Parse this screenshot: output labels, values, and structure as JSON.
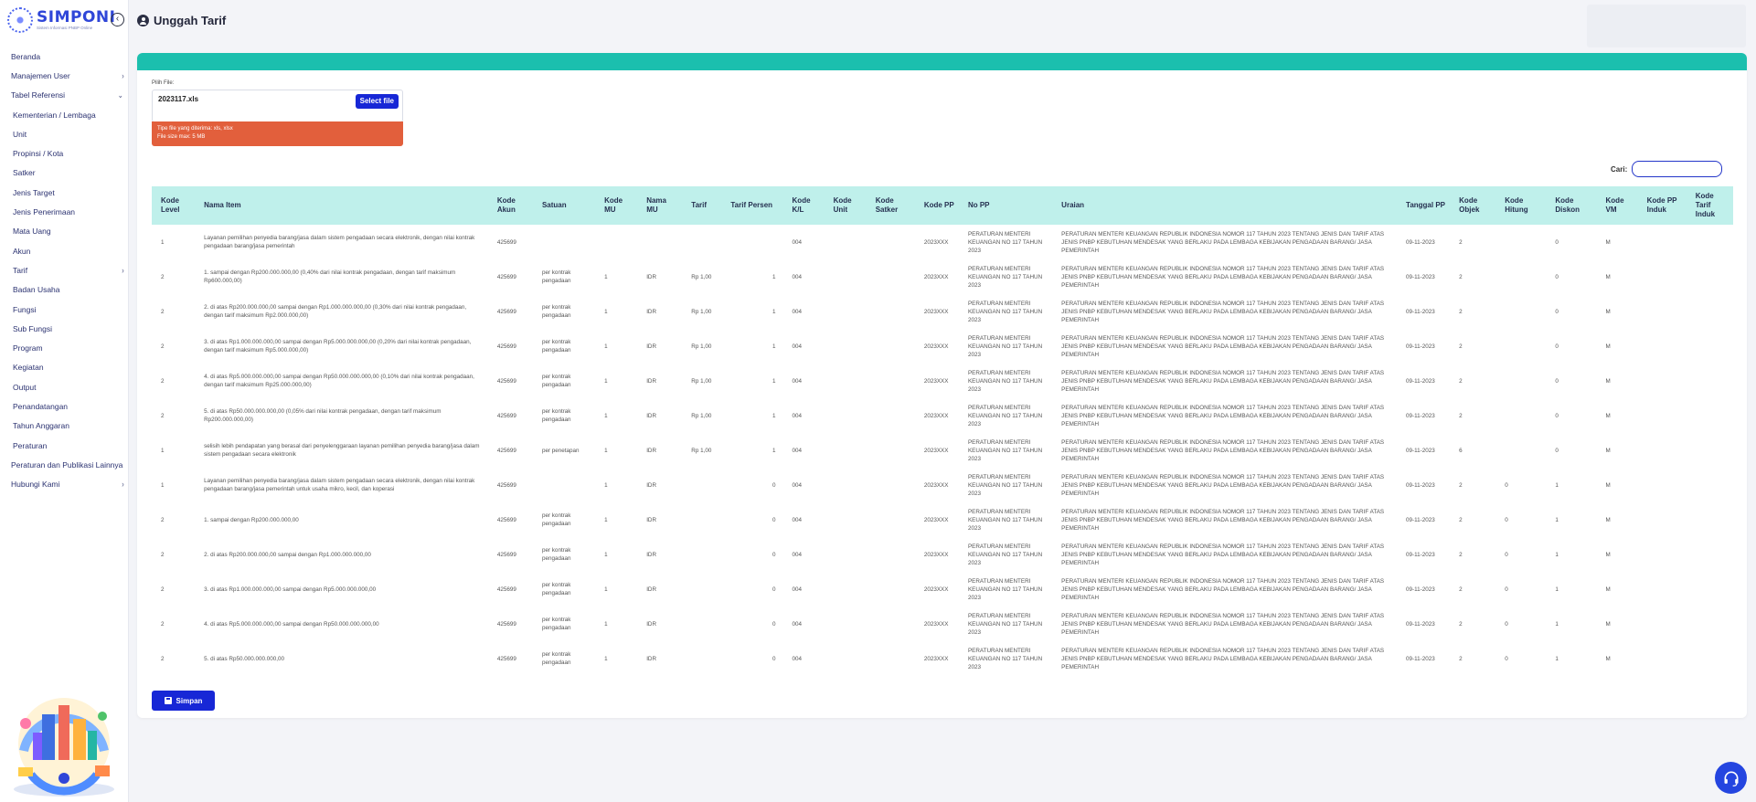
{
  "brand": {
    "name": "SIMPONI",
    "tagline": "Sistem Informasi PNBP Online"
  },
  "page": {
    "title": "Unggah Tarif"
  },
  "sidebar": {
    "items": [
      {
        "label": "Beranda",
        "sub": false,
        "chevron": ""
      },
      {
        "label": "Manajemen User",
        "sub": false,
        "chevron": "›"
      },
      {
        "label": "Tabel Referensi",
        "sub": false,
        "chevron": "⌄"
      },
      {
        "label": "Kementerian / Lembaga",
        "sub": true,
        "chevron": ""
      },
      {
        "label": "Unit",
        "sub": true,
        "chevron": ""
      },
      {
        "label": "Propinsi / Kota",
        "sub": true,
        "chevron": ""
      },
      {
        "label": "Satker",
        "sub": true,
        "chevron": ""
      },
      {
        "label": "Jenis Target",
        "sub": true,
        "chevron": ""
      },
      {
        "label": "Jenis Penerimaan",
        "sub": true,
        "chevron": ""
      },
      {
        "label": "Mata Uang",
        "sub": true,
        "chevron": ""
      },
      {
        "label": "Akun",
        "sub": true,
        "chevron": ""
      },
      {
        "label": "Tarif",
        "sub": true,
        "chevron": "›"
      },
      {
        "label": "Badan Usaha",
        "sub": true,
        "chevron": ""
      },
      {
        "label": "Fungsi",
        "sub": true,
        "chevron": ""
      },
      {
        "label": "Sub Fungsi",
        "sub": true,
        "chevron": ""
      },
      {
        "label": "Program",
        "sub": true,
        "chevron": ""
      },
      {
        "label": "Kegiatan",
        "sub": true,
        "chevron": ""
      },
      {
        "label": "Output",
        "sub": true,
        "chevron": ""
      },
      {
        "label": "Penandatangan",
        "sub": true,
        "chevron": ""
      },
      {
        "label": "Tahun Anggaran",
        "sub": true,
        "chevron": ""
      },
      {
        "label": "Peraturan",
        "sub": true,
        "chevron": ""
      },
      {
        "label": "Peraturan dan Publikasi Lainnya",
        "sub": false,
        "chevron": ""
      },
      {
        "label": "Hubungi Kami",
        "sub": false,
        "chevron": "›"
      }
    ]
  },
  "upload": {
    "label": "Pilih File:",
    "file_name": "2023117.xls",
    "select_label": "Select file",
    "note_types": "Tipe file yang diterima: xls, xlsx",
    "note_size": "File size max: 5 MB"
  },
  "search": {
    "label": "Cari:",
    "value": ""
  },
  "table": {
    "columns": [
      "Kode Level",
      "Nama Item",
      "Kode Akun",
      "Satuan",
      "Kode MU",
      "Nama MU",
      "Tarif",
      "Tarif Persen",
      "Kode K/L",
      "Kode Unit",
      "Kode Satker",
      "Kode PP",
      "No PP",
      "Uraian",
      "Tanggal PP",
      "Kode Objek",
      "Kode Hitung",
      "Kode Diskon",
      "Kode VM",
      "Kode PP Induk",
      "Kode Tarif Induk"
    ],
    "rows": [
      [
        "1",
        "Layanan pemilihan penyedia barang/jasa dalam sistem pengadaan secara elektronik, dengan nilai kontrak pengadaan barang/jasa pemerintah",
        "425699",
        "",
        "",
        "",
        "",
        "",
        "004",
        "",
        "",
        "2023XXX",
        "PERATURAN MENTERI KEUANGAN NO 117 TAHUN 2023",
        "PERATURAN MENTERI KEUANGAN REPUBLIK INDONESIA NOMOR 117 TAHUN 2023 TENTANG JENIS DAN TARIF ATAS JENIS PNBP KEBUTUHAN MENDESAK YANG BERLAKU PADA LEMBAGA KEBIJAKAN PENGADAAN BARANG/ JASA PEMERINTAH",
        "09-11-2023",
        "2",
        "",
        "0",
        "M",
        "",
        ""
      ],
      [
        "2",
        "1.     sampai dengan Rp200.000.000,00 (0,40% dari nilai kontrak pengadaan, dengan tarif maksimum Rp600.000,00)",
        "425699",
        "per kontrak pengadaan",
        "1",
        "IDR",
        "Rp 1,00",
        "1",
        "004",
        "",
        "",
        "2023XXX",
        "PERATURAN MENTERI KEUANGAN NO 117 TAHUN 2023",
        "PERATURAN MENTERI KEUANGAN REPUBLIK INDONESIA NOMOR 117 TAHUN 2023 TENTANG JENIS DAN TARIF ATAS JENIS PNBP KEBUTUHAN MENDESAK YANG BERLAKU PADA LEMBAGA KEBIJAKAN PENGADAAN BARANG/ JASA PEMERINTAH",
        "09-11-2023",
        "2",
        "",
        "0",
        "M",
        "",
        ""
      ],
      [
        "2",
        "2.     di atas Rp200.000.000,00 sampai dengan Rp1.000.000.000,00 (0,30% dari nilai kontrak pengadaan, dengan tarif maksimum Rp2.000.000,00)",
        "425699",
        "per kontrak pengadaan",
        "1",
        "IDR",
        "Rp 1,00",
        "1",
        "004",
        "",
        "",
        "2023XXX",
        "PERATURAN MENTERI KEUANGAN NO 117 TAHUN 2023",
        "PERATURAN MENTERI KEUANGAN REPUBLIK INDONESIA NOMOR 117 TAHUN 2023 TENTANG JENIS DAN TARIF ATAS JENIS PNBP KEBUTUHAN MENDESAK YANG BERLAKU PADA LEMBAGA KEBIJAKAN PENGADAAN BARANG/ JASA PEMERINTAH",
        "09-11-2023",
        "2",
        "",
        "0",
        "M",
        "",
        ""
      ],
      [
        "2",
        "3.     di atas Rp1.000.000.000,00 sampai dengan Rp5.000.000.000,00 (0,20% dari nilai kontrak pengadaan, dengan tarif maksimum Rp5.000.000,00)",
        "425699",
        "per kontrak pengadaan",
        "1",
        "IDR",
        "Rp 1,00",
        "1",
        "004",
        "",
        "",
        "2023XXX",
        "PERATURAN MENTERI KEUANGAN NO 117 TAHUN 2023",
        "PERATURAN MENTERI KEUANGAN REPUBLIK INDONESIA NOMOR 117 TAHUN 2023 TENTANG JENIS DAN TARIF ATAS JENIS PNBP KEBUTUHAN MENDESAK YANG BERLAKU PADA LEMBAGA KEBIJAKAN PENGADAAN BARANG/ JASA PEMERINTAH",
        "09-11-2023",
        "2",
        "",
        "0",
        "M",
        "",
        ""
      ],
      [
        "2",
        "4.     di atas Rp5.000.000.000,00 sampai dengan Rp50.000.000.000,00 (0,10% dari nilai kontrak pengadaan, dengan tarif maksimum Rp25.000.000,00)",
        "425699",
        "per kontrak pengadaan",
        "1",
        "IDR",
        "Rp 1,00",
        "1",
        "004",
        "",
        "",
        "2023XXX",
        "PERATURAN MENTERI KEUANGAN NO 117 TAHUN 2023",
        "PERATURAN MENTERI KEUANGAN REPUBLIK INDONESIA NOMOR 117 TAHUN 2023 TENTANG JENIS DAN TARIF ATAS JENIS PNBP KEBUTUHAN MENDESAK YANG BERLAKU PADA LEMBAGA KEBIJAKAN PENGADAAN BARANG/ JASA PEMERINTAH",
        "09-11-2023",
        "2",
        "",
        "0",
        "M",
        "",
        ""
      ],
      [
        "2",
        "5.     di atas Rp50.000.000.000,00 (0,05% dari nilai kontrak pengadaan, dengan tarif maksimum Rp200.000.000,00)",
        "425699",
        "per kontrak pengadaan",
        "1",
        "IDR",
        "Rp 1,00",
        "1",
        "004",
        "",
        "",
        "2023XXX",
        "PERATURAN MENTERI KEUANGAN NO 117 TAHUN 2023",
        "PERATURAN MENTERI KEUANGAN REPUBLIK INDONESIA NOMOR 117 TAHUN 2023 TENTANG JENIS DAN TARIF ATAS JENIS PNBP KEBUTUHAN MENDESAK YANG BERLAKU PADA LEMBAGA KEBIJAKAN PENGADAAN BARANG/ JASA PEMERINTAH",
        "09-11-2023",
        "2",
        "",
        "0",
        "M",
        "",
        ""
      ],
      [
        "1",
        "selisih lebih pendapatan yang berasal dari penyelenggaraan layanan pemilihan penyedia barang/jasa dalam sistem pengadaan secara elektronik",
        "425699",
        "per penetapan",
        "1",
        "IDR",
        "Rp 1,00",
        "1",
        "004",
        "",
        "",
        "2023XXX",
        "PERATURAN MENTERI KEUANGAN NO 117 TAHUN 2023",
        "PERATURAN MENTERI KEUANGAN REPUBLIK INDONESIA NOMOR 117 TAHUN 2023 TENTANG JENIS DAN TARIF ATAS JENIS PNBP KEBUTUHAN MENDESAK YANG BERLAKU PADA LEMBAGA KEBIJAKAN PENGADAAN BARANG/ JASA PEMERINTAH",
        "09-11-2023",
        "6",
        "",
        "0",
        "M",
        "",
        ""
      ],
      [
        "1",
        "Layanan pemilihan penyedia barang/jasa dalam sistem pengadaan secara elektronik, dengan nilai kontrak pengadaan barang/jasa pemerintah untuk usaha mikro, kecil, dan koperasi",
        "425699",
        "",
        "1",
        "IDR",
        "",
        "0",
        "004",
        "",
        "",
        "2023XXX",
        "PERATURAN MENTERI KEUANGAN NO 117 TAHUN 2023",
        "PERATURAN MENTERI KEUANGAN REPUBLIK INDONESIA NOMOR 117 TAHUN 2023 TENTANG JENIS DAN TARIF ATAS JENIS PNBP KEBUTUHAN MENDESAK YANG BERLAKU PADA LEMBAGA KEBIJAKAN PENGADAAN BARANG/ JASA PEMERINTAH",
        "09-11-2023",
        "2",
        "0",
        "1",
        "M",
        "",
        ""
      ],
      [
        "2",
        "1.     sampai dengan Rp200.000.000,00",
        "425699",
        "per kontrak pengadaan",
        "1",
        "IDR",
        "",
        "0",
        "004",
        "",
        "",
        "2023XXX",
        "PERATURAN MENTERI KEUANGAN NO 117 TAHUN 2023",
        "PERATURAN MENTERI KEUANGAN REPUBLIK INDONESIA NOMOR 117 TAHUN 2023 TENTANG JENIS DAN TARIF ATAS JENIS PNBP KEBUTUHAN MENDESAK YANG BERLAKU PADA LEMBAGA KEBIJAKAN PENGADAAN BARANG/ JASA PEMERINTAH",
        "09-11-2023",
        "2",
        "0",
        "1",
        "M",
        "",
        ""
      ],
      [
        "2",
        "2.     di atas Rp200.000.000,00 sampai dengan Rp1.000.000.000,00",
        "425699",
        "per kontrak pengadaan",
        "1",
        "IDR",
        "",
        "0",
        "004",
        "",
        "",
        "2023XXX",
        "PERATURAN MENTERI KEUANGAN NO 117 TAHUN 2023",
        "PERATURAN MENTERI KEUANGAN REPUBLIK INDONESIA NOMOR 117 TAHUN 2023 TENTANG JENIS DAN TARIF ATAS JENIS PNBP KEBUTUHAN MENDESAK YANG BERLAKU PADA LEMBAGA KEBIJAKAN PENGADAAN BARANG/ JASA PEMERINTAH",
        "09-11-2023",
        "2",
        "0",
        "1",
        "M",
        "",
        ""
      ],
      [
        "2",
        "3.     di atas Rp1.000.000.000,00 sampai dengan Rp5.000.000.000,00",
        "425699",
        "per kontrak pengadaan",
        "1",
        "IDR",
        "",
        "0",
        "004",
        "",
        "",
        "2023XXX",
        "PERATURAN MENTERI KEUANGAN NO 117 TAHUN 2023",
        "PERATURAN MENTERI KEUANGAN REPUBLIK INDONESIA NOMOR 117 TAHUN 2023 TENTANG JENIS DAN TARIF ATAS JENIS PNBP KEBUTUHAN MENDESAK YANG BERLAKU PADA LEMBAGA KEBIJAKAN PENGADAAN BARANG/ JASA PEMERINTAH",
        "09-11-2023",
        "2",
        "0",
        "1",
        "M",
        "",
        ""
      ],
      [
        "2",
        "4.     di atas Rp5.000.000.000,00 sampai dengan Rp50.000.000.000,00",
        "425699",
        "per kontrak pengadaan",
        "1",
        "IDR",
        "",
        "0",
        "004",
        "",
        "",
        "2023XXX",
        "PERATURAN MENTERI KEUANGAN NO 117 TAHUN 2023",
        "PERATURAN MENTERI KEUANGAN REPUBLIK INDONESIA NOMOR 117 TAHUN 2023 TENTANG JENIS DAN TARIF ATAS JENIS PNBP KEBUTUHAN MENDESAK YANG BERLAKU PADA LEMBAGA KEBIJAKAN PENGADAAN BARANG/ JASA PEMERINTAH",
        "09-11-2023",
        "2",
        "0",
        "1",
        "M",
        "",
        ""
      ],
      [
        "2",
        "5.     di atas Rp50.000.000.000,00",
        "425699",
        "per kontrak pengadaan",
        "1",
        "IDR",
        "",
        "0",
        "004",
        "",
        "",
        "2023XXX",
        "PERATURAN MENTERI KEUANGAN NO 117 TAHUN 2023",
        "PERATURAN MENTERI KEUANGAN REPUBLIK INDONESIA NOMOR 117 TAHUN 2023 TENTANG JENIS DAN TARIF ATAS JENIS PNBP KEBUTUHAN MENDESAK YANG BERLAKU PADA LEMBAGA KEBIJAKAN PENGADAAN BARANG/ JASA PEMERINTAH",
        "09-11-2023",
        "2",
        "0",
        "1",
        "M",
        "",
        ""
      ]
    ]
  },
  "actions": {
    "save_label": "Simpan"
  },
  "icons": {
    "collapse": "chevron-left-icon",
    "user": "user-circle-icon",
    "save": "floppy-disk-icon",
    "help": "headset-icon"
  },
  "colors": {
    "primary": "#1727d6",
    "accent_teal": "#1bbfae",
    "table_header": "#bff0eb",
    "warning": "#e25f3c",
    "sidebar_text": "#2a3170"
  }
}
